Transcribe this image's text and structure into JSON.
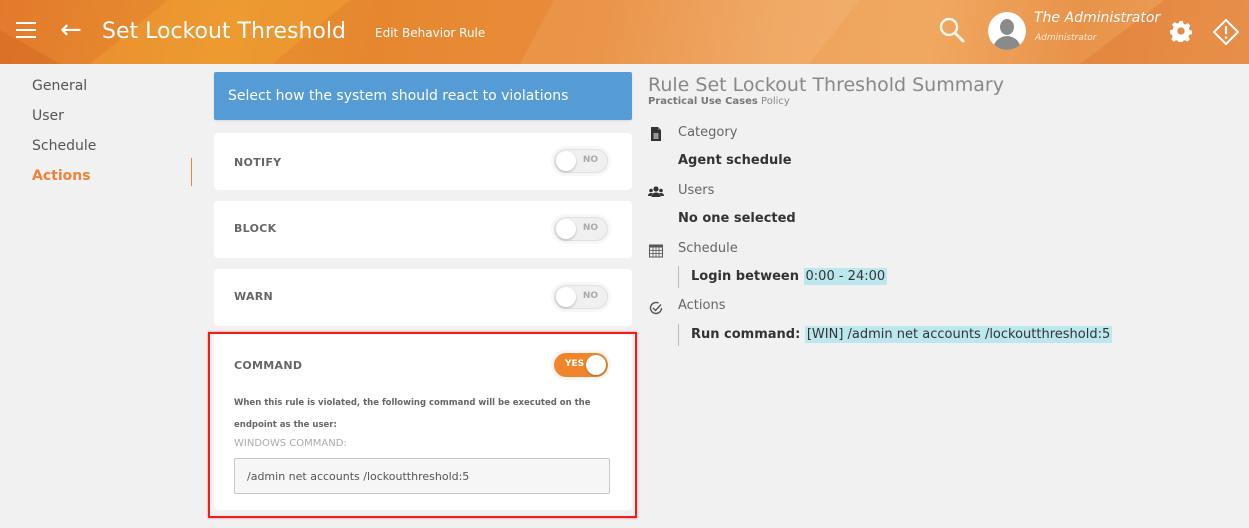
{
  "header": {
    "menu_icon": "hamburger-menu-icon",
    "back_icon": "arrow-left-icon",
    "title": "Set Lockout Threshold",
    "subtitle": "Edit Behavior Rule",
    "search_icon": "search-icon",
    "user": {
      "name": "The Administrator",
      "role": "Administrator"
    },
    "settings_icon": "gear-icon",
    "alert_icon": "alert-diamond-icon"
  },
  "nav": {
    "items": [
      {
        "label": "General",
        "active": false
      },
      {
        "label": "User",
        "active": false
      },
      {
        "label": "Schedule",
        "active": false
      },
      {
        "label": "Actions",
        "active": true
      }
    ]
  },
  "actions": {
    "banner": "Select how the system should react to violations",
    "cards": [
      {
        "label": "NOTIFY",
        "toggle": "NO",
        "enabled": false
      },
      {
        "label": "BLOCK",
        "toggle": "NO",
        "enabled": false
      },
      {
        "label": "WARN",
        "toggle": "NO",
        "enabled": false
      },
      {
        "label": "COMMAND",
        "toggle": "YES",
        "enabled": true
      }
    ],
    "command": {
      "description": "When this rule is violated, the following command will be executed on the endpoint as the user:",
      "field_label": "WINDOWS COMMAND:",
      "value": "/admin net accounts /lockoutthreshold:5"
    }
  },
  "summary": {
    "title": "Rule Set Lockout Threshold Summary",
    "policy_name": "Practical Use Cases",
    "policy_suffix": "Policy",
    "category": {
      "heading": "Category",
      "value": "Agent schedule"
    },
    "users": {
      "heading": "Users",
      "value": "No one selected"
    },
    "schedule": {
      "heading": "Schedule",
      "prefix": "Login between",
      "value": "0:00 - 24:00"
    },
    "actions": {
      "heading": "Actions",
      "prefix": "Run command:",
      "value": "[WIN] /admin net accounts /lockoutthreshold:5"
    }
  },
  "colors": {
    "accent": "#f0823a",
    "banner": "#559bd6",
    "highlight": "#bde7ef",
    "selection_box": "#f21c1c"
  }
}
